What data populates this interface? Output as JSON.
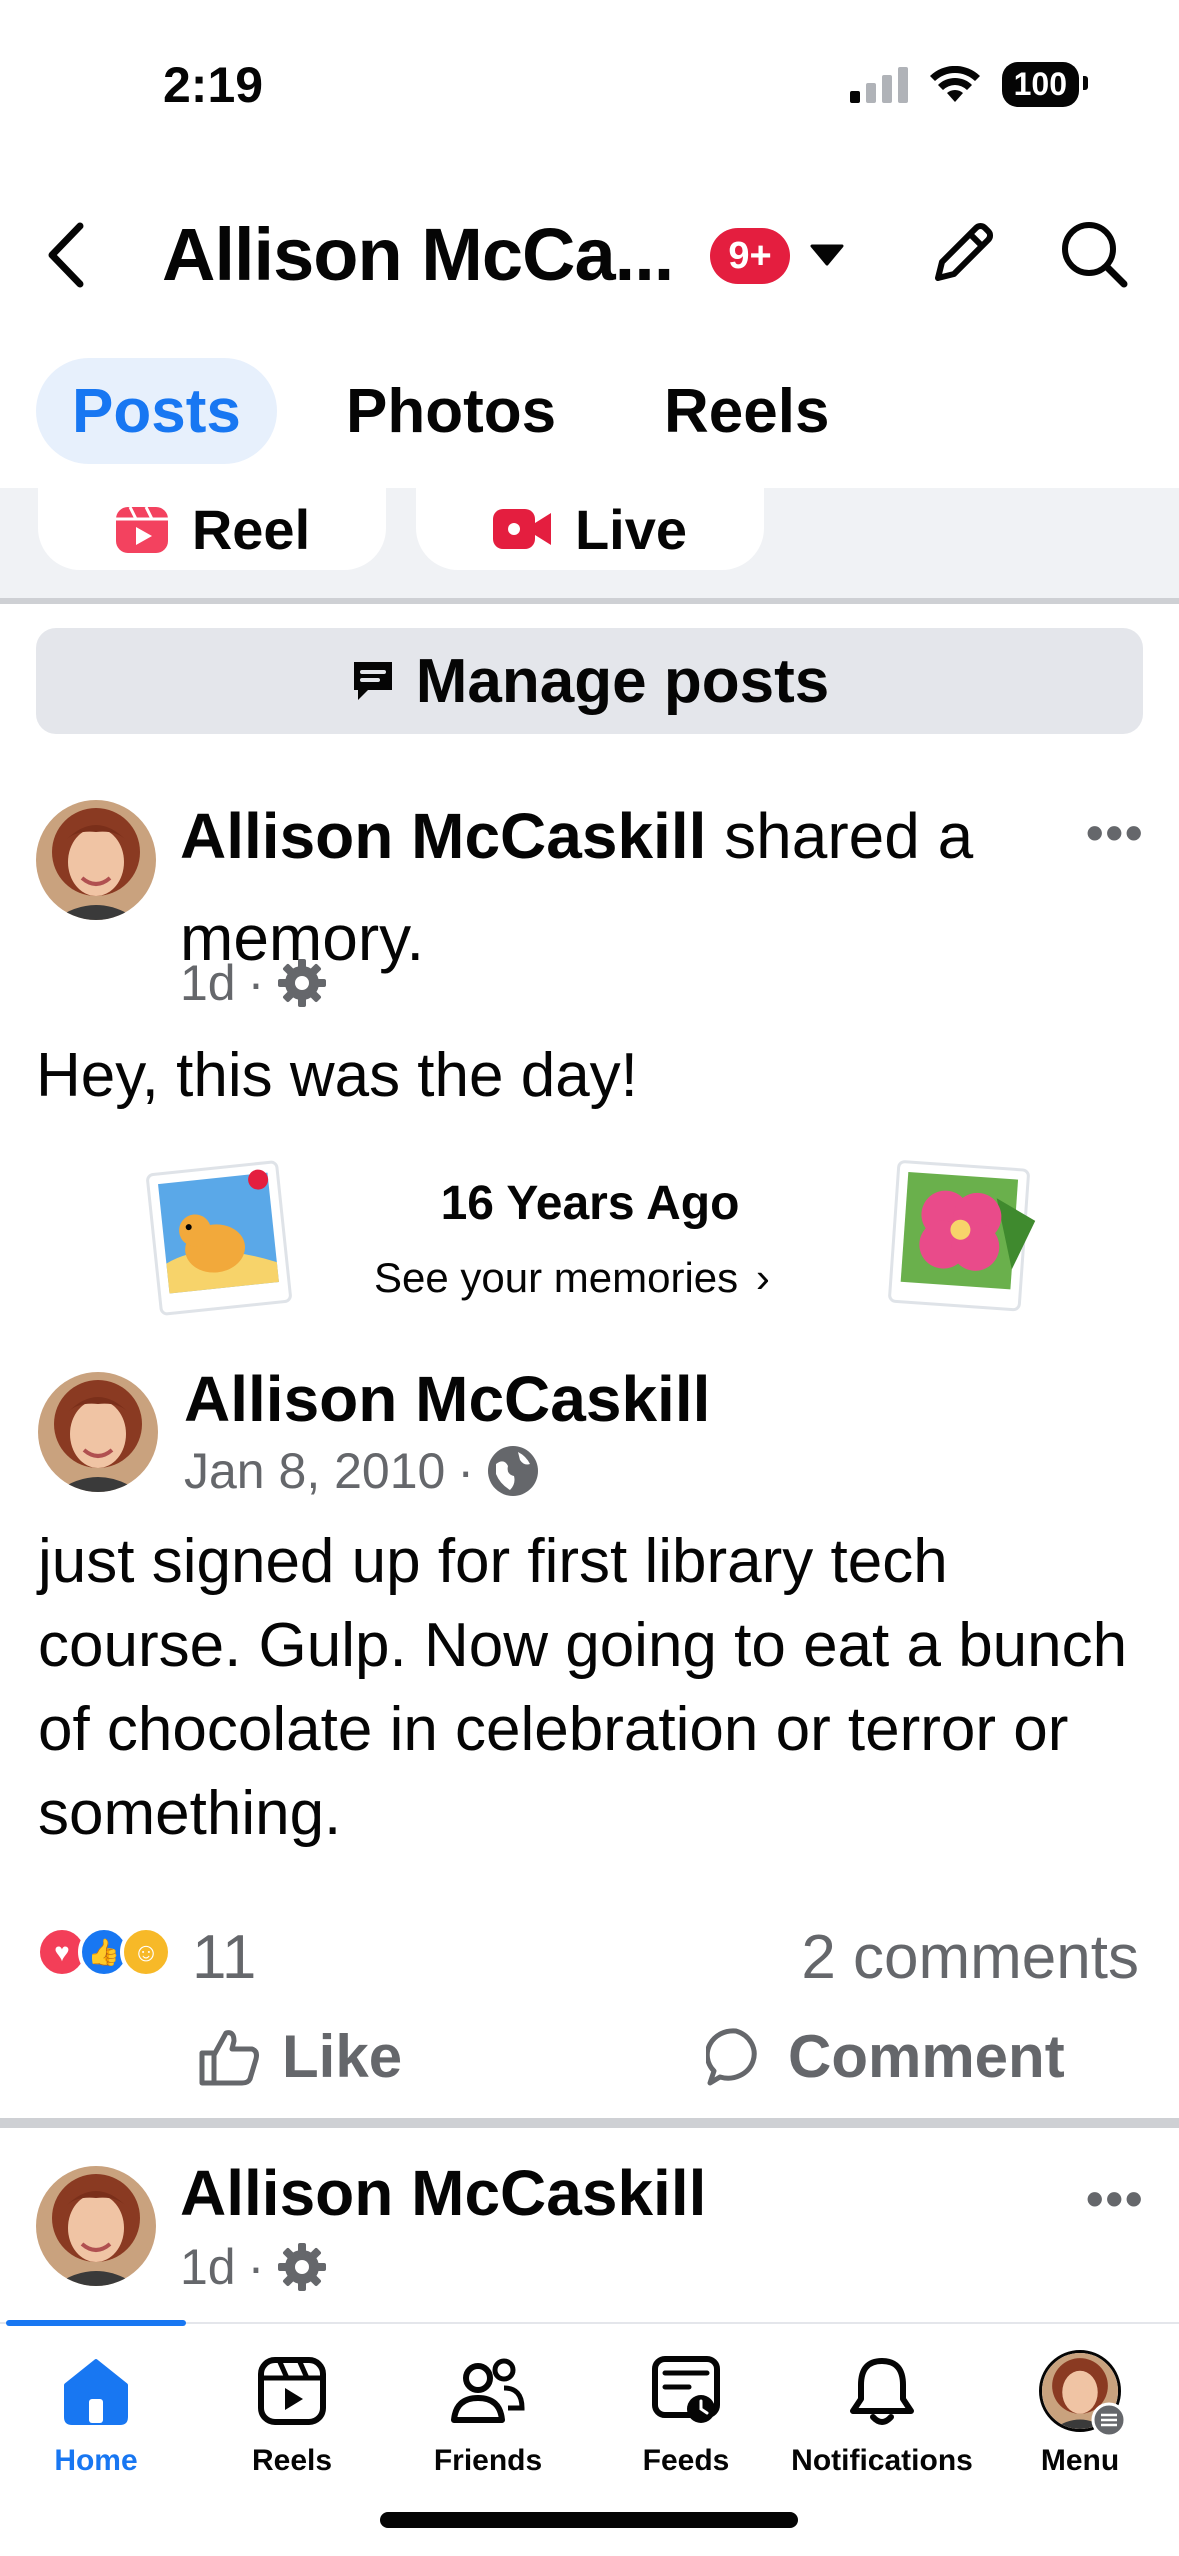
{
  "status_bar": {
    "time": "2:19",
    "battery": "100"
  },
  "header": {
    "title": "Allison McCa...",
    "badge": "9+"
  },
  "tabs": [
    {
      "label": "Posts",
      "active": true
    },
    {
      "label": "Photos",
      "active": false
    },
    {
      "label": "Reels",
      "active": false
    }
  ],
  "create_chips": {
    "reel": "Reel",
    "live": "Live"
  },
  "manage_posts": "Manage posts",
  "memory_post": {
    "author": "Allison McCaskill",
    "action": " shared a memory.",
    "time": "1d",
    "text": "Hey, this was the day!",
    "memory_title": "16 Years Ago",
    "memory_link": "See your memories",
    "original": {
      "author": "Allison McCaskill",
      "date": "Jan 8, 2010",
      "text": "just signed up for first library tech course.  Gulp.  Now going to eat a bunch of chocolate in celebration or terror or something."
    },
    "reaction_count": "11",
    "comments": "2 comments",
    "actions": {
      "like": "Like",
      "comment": "Comment"
    }
  },
  "next_post": {
    "author": "Allison McCaskill",
    "time": "1d"
  },
  "nav": [
    {
      "label": "Home",
      "icon": "home-icon",
      "active": true
    },
    {
      "label": "Reels",
      "icon": "reels-icon",
      "active": false
    },
    {
      "label": "Friends",
      "icon": "friends-icon",
      "active": false
    },
    {
      "label": "Feeds",
      "icon": "feeds-icon",
      "active": false
    },
    {
      "label": "Notifications",
      "icon": "bell-icon",
      "active": false
    },
    {
      "label": "Menu",
      "icon": "profile-avatar",
      "active": false
    }
  ],
  "colors": {
    "accent": "#1877f2",
    "badge": "#e41e3f",
    "secondary_text": "#65676b"
  }
}
